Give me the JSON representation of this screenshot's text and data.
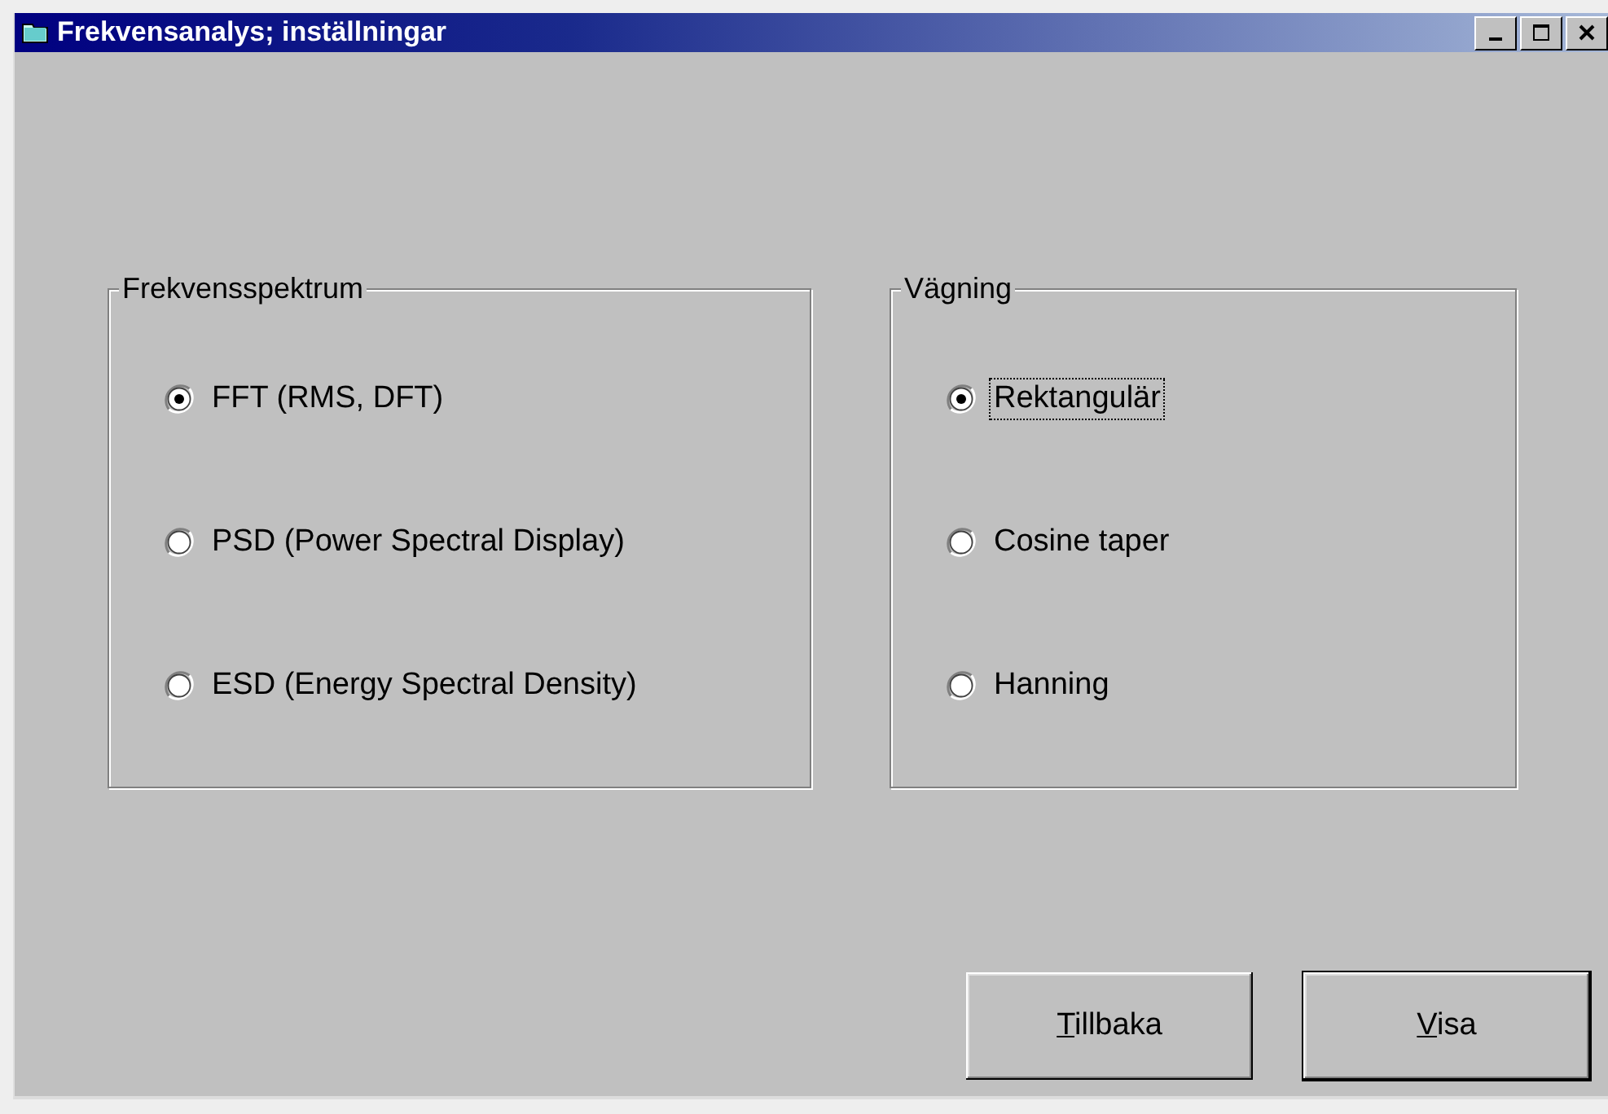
{
  "window": {
    "title": "Frekvensanalys; inställningar"
  },
  "groups": [
    {
      "title": "Frekvensspektrum",
      "options": [
        {
          "label": "FFT (RMS, DFT)",
          "selected": true,
          "focused": false
        },
        {
          "label": "PSD (Power Spectral Display)",
          "selected": false,
          "focused": false
        },
        {
          "label": "ESD (Energy Spectral Density)",
          "selected": false,
          "focused": false
        }
      ]
    },
    {
      "title": "Vägning",
      "options": [
        {
          "label": "Rektangulär",
          "selected": true,
          "focused": true
        },
        {
          "label": "Cosine taper",
          "selected": false,
          "focused": false
        },
        {
          "label": "Hanning",
          "selected": false,
          "focused": false
        }
      ]
    }
  ],
  "buttons": [
    {
      "accel": "T",
      "rest": "illbaka",
      "default": false
    },
    {
      "accel": "V",
      "rest": "isa",
      "default": true
    }
  ]
}
